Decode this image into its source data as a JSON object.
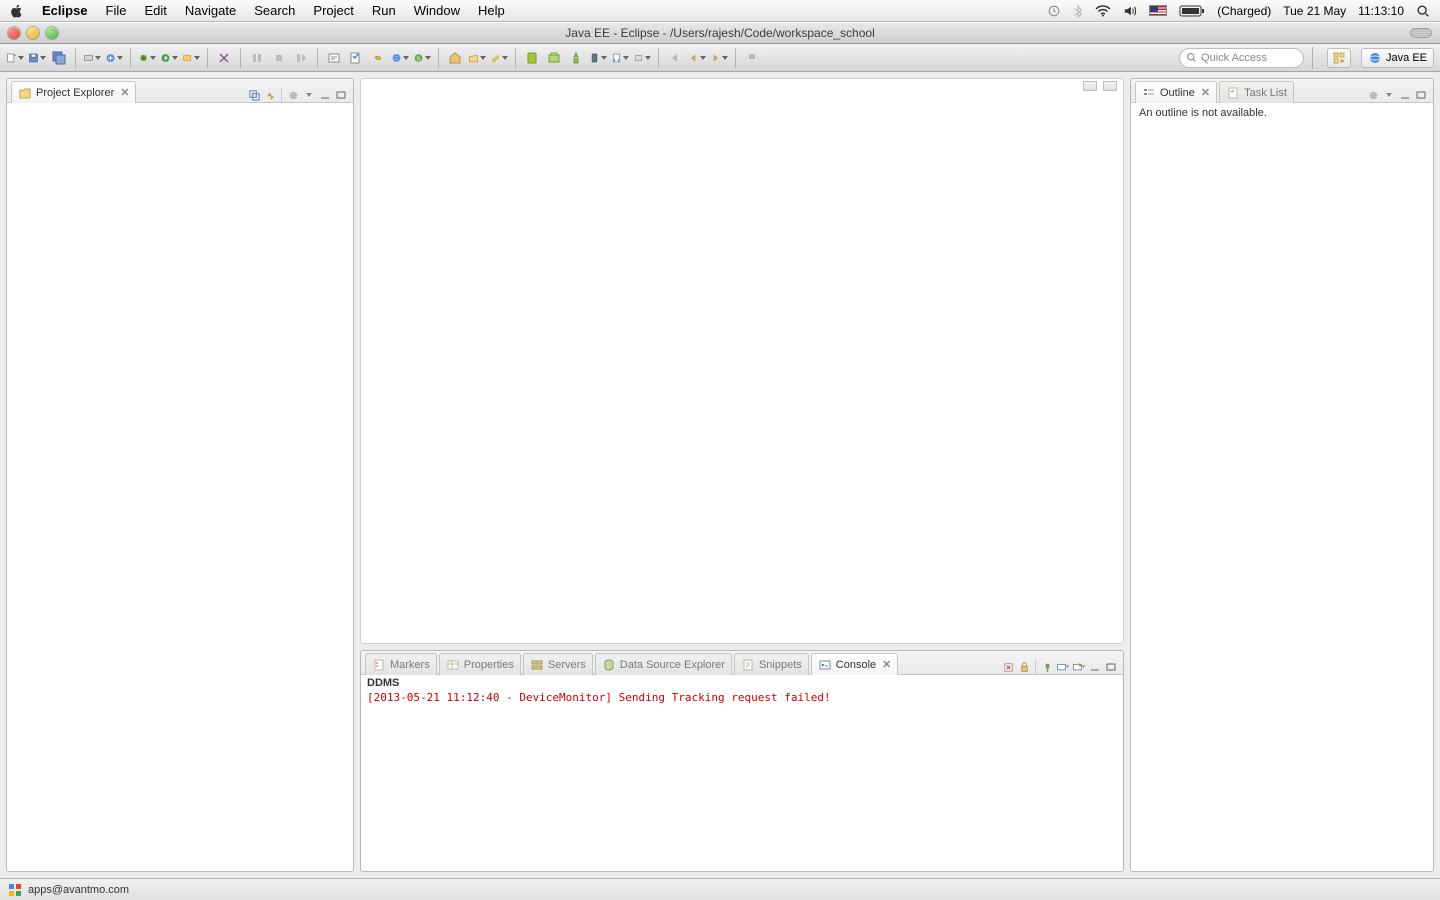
{
  "mac_menu": {
    "app": "Eclipse",
    "items": [
      "File",
      "Edit",
      "Navigate",
      "Search",
      "Project",
      "Run",
      "Window",
      "Help"
    ],
    "battery": "(Charged)",
    "date": "Tue 21 May",
    "time": "11:13:10"
  },
  "window": {
    "title": "Java EE - Eclipse - /Users/rajesh/Code/workspace_school"
  },
  "toolbar": {
    "quick_access_placeholder": "Quick Access",
    "perspective": "Java EE"
  },
  "left_panel": {
    "tabs": [
      {
        "label": "Project Explorer"
      }
    ]
  },
  "right_panel": {
    "tabs": [
      {
        "label": "Outline"
      },
      {
        "label": "Task List"
      }
    ],
    "outline_message": "An outline is not available."
  },
  "bottom_panel": {
    "tabs": [
      "Markers",
      "Properties",
      "Servers",
      "Data Source Explorer",
      "Snippets",
      "Console"
    ],
    "active_tab": "Console",
    "console": {
      "header": "DDMS",
      "line": "[2013-05-21 11:12:40 - DeviceMonitor] Sending Tracking request failed!"
    }
  },
  "statusbar": {
    "text": "apps@avantmo.com"
  }
}
